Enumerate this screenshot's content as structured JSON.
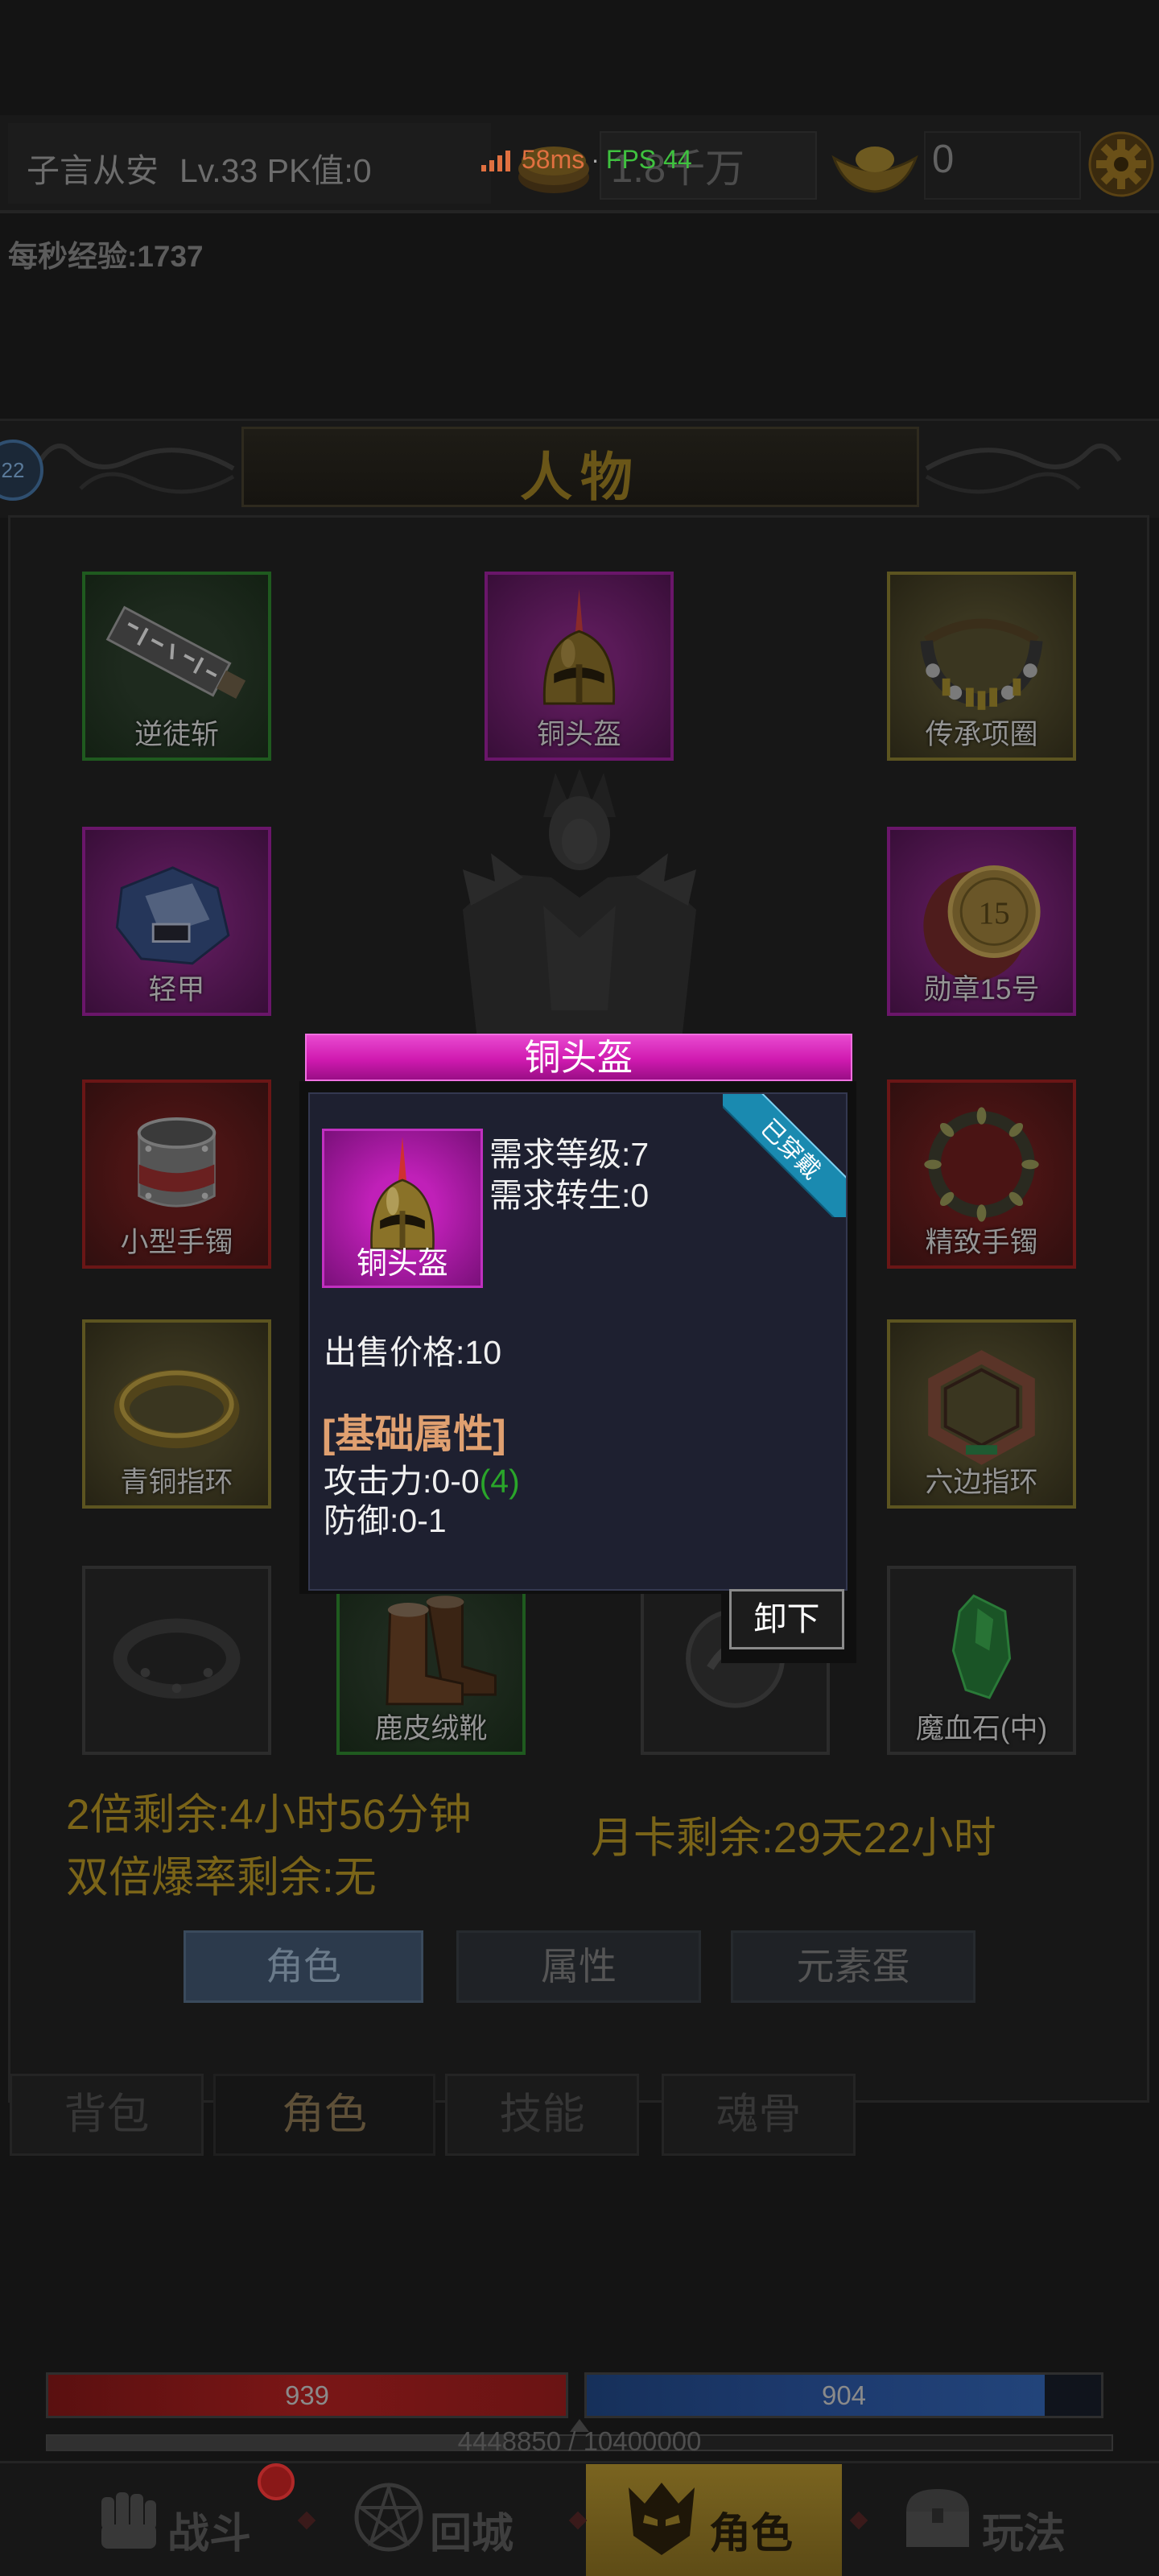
{
  "top_bar": {
    "player_name": "子言从安",
    "level_pk": "Lv.33 PK值:0",
    "ping": "58ms",
    "separator": "·",
    "fps": "FPS 44",
    "gold": "1.8千万",
    "ingot": "0"
  },
  "exp_rate": "每秒经验:1737",
  "panel": {
    "title": "人物",
    "side_badge": "22"
  },
  "equipment": [
    {
      "label": "逆徒斩",
      "rarity": "green"
    },
    {
      "label": "铜头盔",
      "rarity": "purple"
    },
    {
      "label": "传承项圈",
      "rarity": "yellow"
    },
    {
      "label": "轻甲",
      "rarity": "purple"
    },
    {
      "label": "勋章15号",
      "rarity": "purple",
      "icon_number": "15"
    },
    {
      "label": "小型手镯",
      "rarity": "red"
    },
    {
      "label": "精致手镯",
      "rarity": "red"
    },
    {
      "label": "青铜指环",
      "rarity": "yellow"
    },
    {
      "label": "六边指环",
      "rarity": "yellow"
    },
    {
      "rarity": "gray"
    },
    {
      "label": "鹿皮绒靴",
      "rarity": "green"
    },
    {
      "rarity": "gray"
    },
    {
      "label": "魔血石(中)",
      "rarity": "gray"
    }
  ],
  "item_popup": {
    "title": "铜头盔",
    "equipped_badge": "已穿戴",
    "icon_label": "铜头盔",
    "req_level": "需求等级:7",
    "req_rebirth": "需求转生:0",
    "sell_price": "出售价格:10",
    "section_title": "[基础属性]",
    "attack": "攻击力:0-0",
    "attack_bonus": "(4)",
    "defense": "防御:0-1",
    "unequip_button": "卸下"
  },
  "buffs": {
    "double_exp": "2倍剩余:4小时56分钟",
    "double_drop": "双倍爆率剩余:无",
    "monthly_card": "月卡剩余:29天22小时"
  },
  "sub_tabs": [
    {
      "label": "角色",
      "active": true
    },
    {
      "label": "属性"
    },
    {
      "label": "元素蛋"
    }
  ],
  "bag_tabs": [
    {
      "label": "背包"
    },
    {
      "label": "角色",
      "active": true
    },
    {
      "label": "技能"
    },
    {
      "label": "魂骨"
    }
  ],
  "vitals": {
    "hp": "939",
    "hp_fill": 1.0,
    "mp": "904",
    "mp_fill": 0.89,
    "exp": "4448850 / 10400000",
    "exp_fill": 0.43
  },
  "nav": [
    {
      "label": "战斗",
      "icon": "fist-icon",
      "badge": true
    },
    {
      "label": "回城",
      "icon": "pentagram-icon"
    },
    {
      "label": "角色",
      "icon": "mask-icon",
      "active": true
    },
    {
      "label": "玩法",
      "icon": "chest-icon"
    }
  ],
  "colors": {
    "background": "#141414",
    "gold_text": "#7a6418",
    "ping": "#e07040",
    "fps": "#3fc23f",
    "attack_bonus": "#2aa52a",
    "section_title": "#e0a070",
    "popup_title": "#d01ab0",
    "equipped_ribbon": "#1a8ab0",
    "hp_color": "#7a1616",
    "mp_color": "#1d3a6e"
  }
}
